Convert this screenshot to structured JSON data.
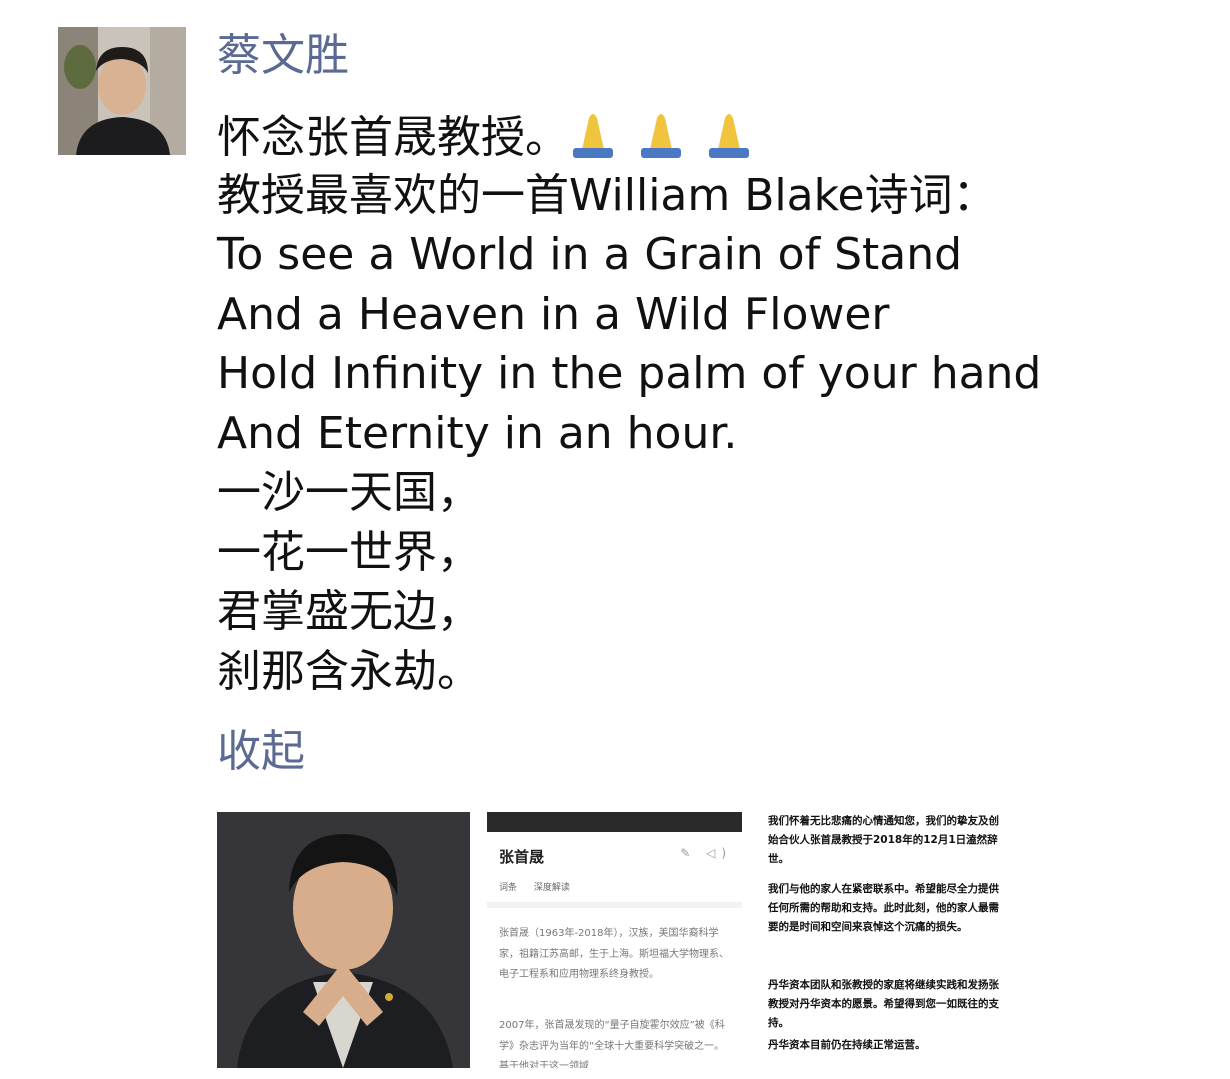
{
  "post": {
    "author": "蔡文胜",
    "lines": [
      "怀念张首晟教授。",
      "教授最喜欢的一首William Blake诗词：",
      "To see a World in a Grain of Stand",
      "And a Heaven in a Wild Flower",
      "Hold Infinity in the palm of your hand",
      "And Eternity in an hour.",
      "一沙一天国，",
      "一花一世界，",
      "君掌盛无边，",
      "刹那含永劫。"
    ],
    "emoji": "🙏🙏🙏",
    "collapse_label": "收起"
  },
  "thumbnails": {
    "second": {
      "name": "张首晟",
      "tabs": [
        "词条",
        "深度解读"
      ],
      "para1": "张首晟（1963年-2018年），汉族，美国华裔科学家，祖籍江苏高邮，生于上海。斯坦福大学物理系、电子工程系和应用物理系终身教授。",
      "para2": "2007年，张首晟发现的“量子自旋霍尔效应”被《科学》杂志评为当年的“全球十大重要科学突破之一。基于他对于这一领域"
    },
    "third": {
      "para1": "我们怀着无比悲痛的心情通知您，我们的挚友及创始合伙人张首晟教授于2018年的12月1日溘然辞世。",
      "para2": "我们与他的家人在紧密联系中。希望能尽全力提供任何所需的帮助和支持。此时此刻，他的家人最需要的是时间和空间来哀悼这个沉痛的损失。",
      "para3": "丹华资本团队和张教授的家庭将继续实践和发扬张教授对丹华资本的愿景。希望得到您一如既往的支持。",
      "para4": "丹华资本目前仍在持续正常运营。"
    }
  }
}
